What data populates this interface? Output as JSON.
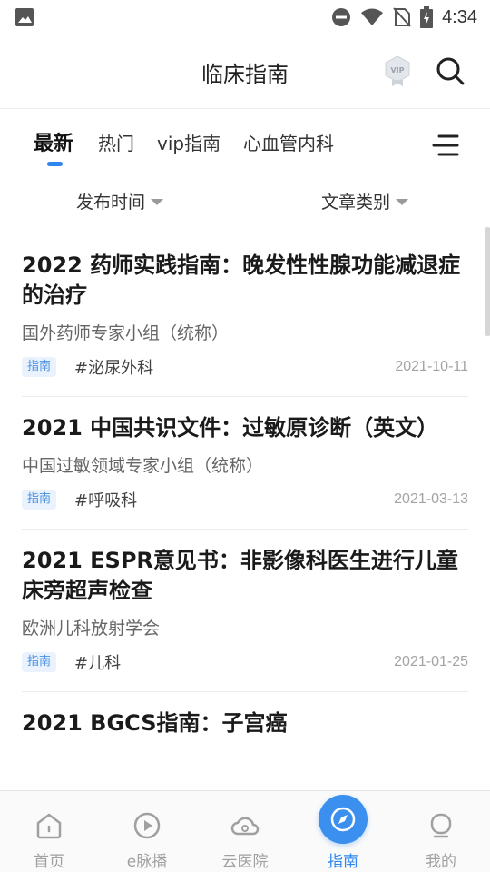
{
  "status_bar": {
    "time": "4:34"
  },
  "header": {
    "title": "临床指南",
    "vip_badge": "VIP"
  },
  "tabs": [
    {
      "label": "最新",
      "active": true
    },
    {
      "label": "热门",
      "active": false
    },
    {
      "label": "vip指南",
      "active": false
    },
    {
      "label": "心血管内科",
      "active": false
    }
  ],
  "filters": {
    "publish_time": "发布时间",
    "article_type": "文章类别"
  },
  "articles": [
    {
      "title": "2022 药师实践指南：晚发性性腺功能减退症的治疗",
      "author": "国外药师专家小组（统称）",
      "tag": "指南",
      "dept": "#泌尿外科",
      "date": "2021-10-11"
    },
    {
      "title": "2021 中国共识文件：过敏原诊断（英文）",
      "author": "中国过敏领域专家小组（统称）",
      "tag": "指南",
      "dept": "#呼吸科",
      "date": "2021-03-13"
    },
    {
      "title": "2021 ESPR意见书：非影像科医生进行儿童床旁超声检查",
      "author": "欧洲儿科放射学会",
      "tag": "指南",
      "dept": "#儿科",
      "date": "2021-01-25"
    },
    {
      "title": "2021 BGCS指南：子宫癌"
    }
  ],
  "bottom_nav": [
    {
      "label": "首页",
      "icon": "home-icon",
      "active": false
    },
    {
      "label": "e脉播",
      "icon": "play-icon",
      "active": false
    },
    {
      "label": "云医院",
      "icon": "cloud-icon",
      "active": false
    },
    {
      "label": "指南",
      "icon": "compass-icon",
      "active": true
    },
    {
      "label": "我的",
      "icon": "profile-icon",
      "active": false
    }
  ],
  "colors": {
    "accent": "#2f86ee",
    "tag_bg": "#e9f2fd",
    "inactive_nav": "#a0a0a0"
  }
}
